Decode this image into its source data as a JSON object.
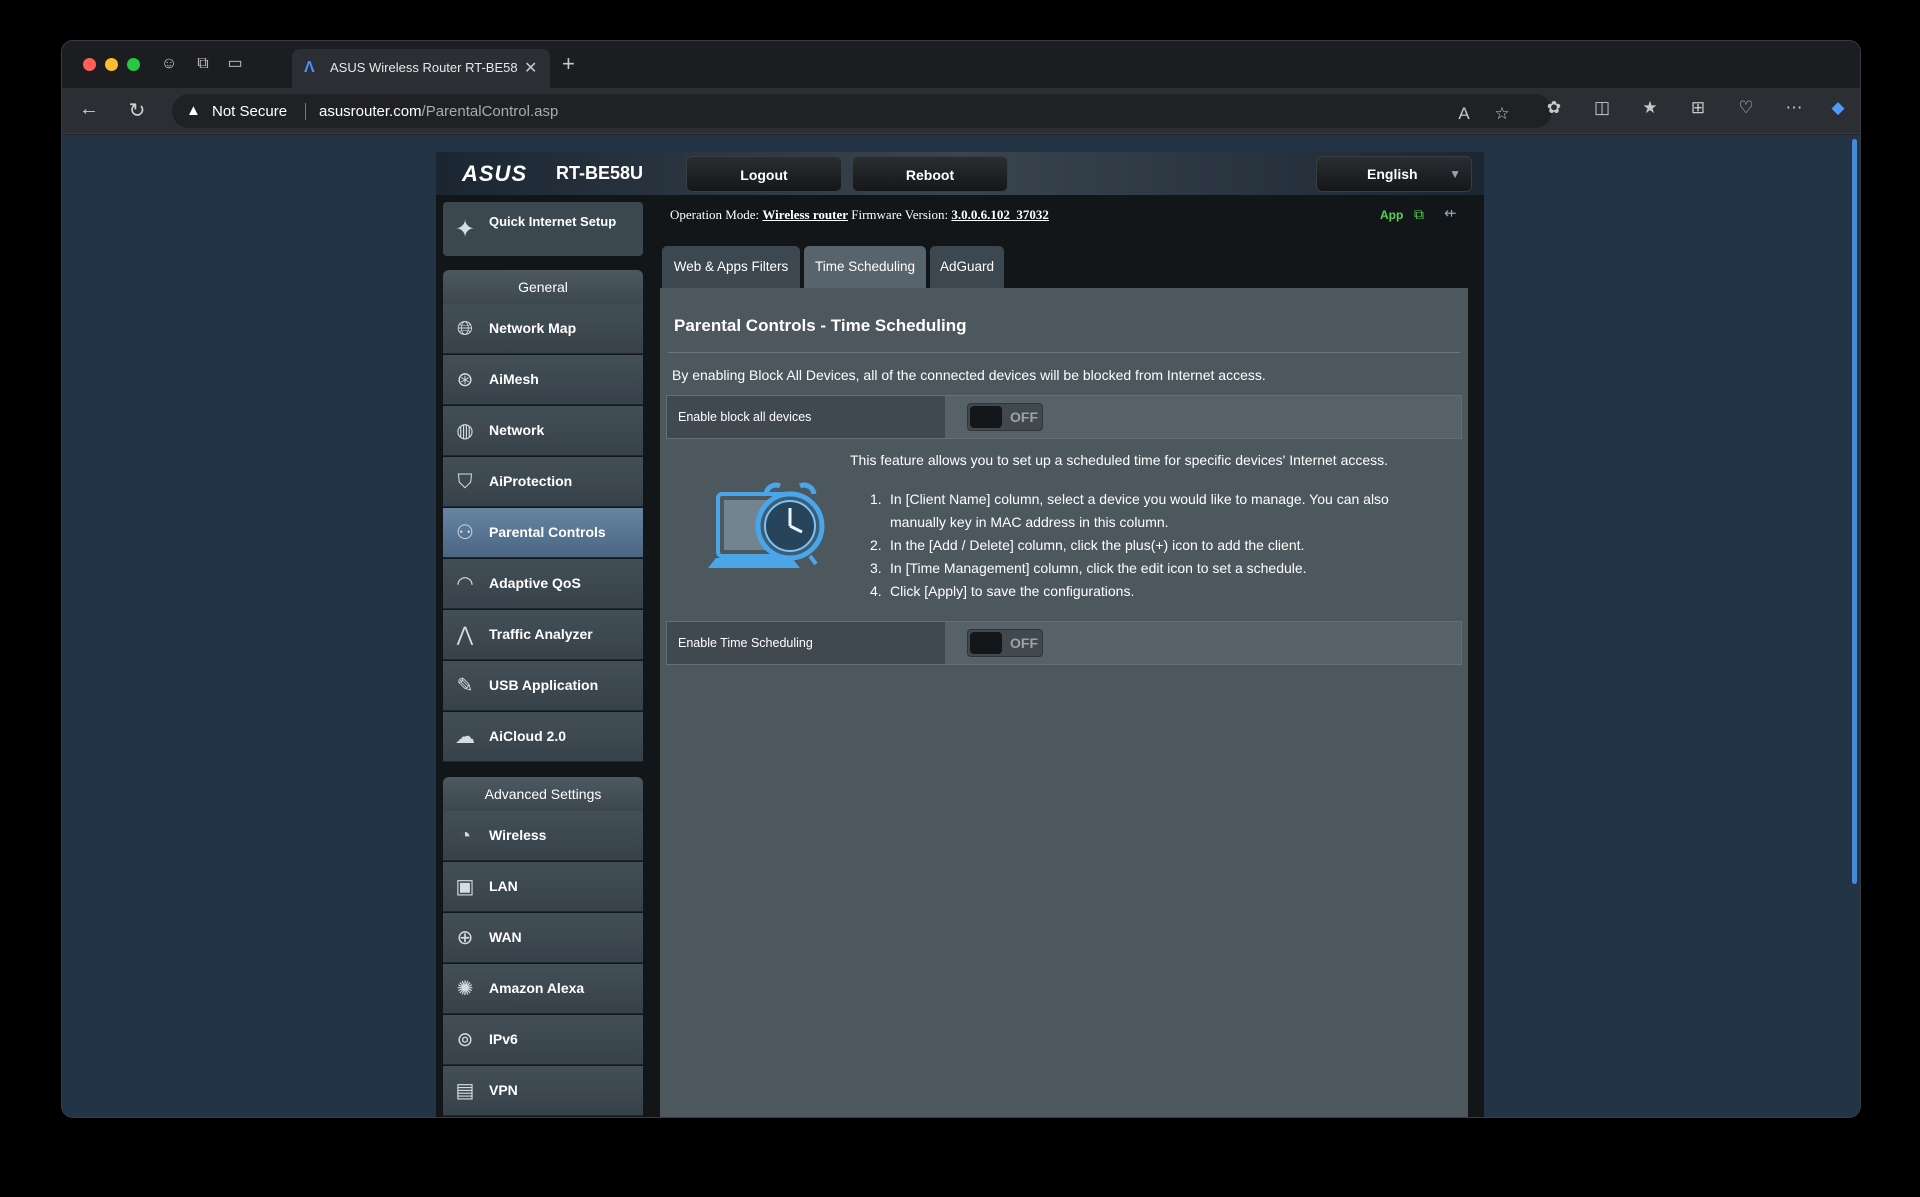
{
  "browser": {
    "tab_title": "ASUS Wireless Router RT-BE58U",
    "not_secure": "Not Secure",
    "url_host": "asusrouter.com",
    "url_path": "/ParentalControl.asp"
  },
  "router": {
    "brand": "ASUS",
    "model": "RT-BE58U",
    "logout": "Logout",
    "reboot": "Reboot",
    "language": "English",
    "opmode_label": "Operation Mode:",
    "opmode_value": "Wireless router",
    "firmware_label": "Firmware Version:",
    "firmware_value": "3.0.0.6.102_37032",
    "app_label": "App"
  },
  "sidebar": {
    "quick_setup": "Quick Internet Setup",
    "general_heading": "General",
    "general_items": [
      {
        "label": "Network Map",
        "icon": "globe-map-icon"
      },
      {
        "label": "AiMesh",
        "icon": "mesh-icon"
      },
      {
        "label": "Network",
        "icon": "network-icon"
      },
      {
        "label": "AiProtection",
        "icon": "shield-lock-icon"
      },
      {
        "label": "Parental Controls",
        "icon": "family-icon"
      },
      {
        "label": "Adaptive QoS",
        "icon": "speedometer-icon"
      },
      {
        "label": "Traffic Analyzer",
        "icon": "waveform-icon"
      },
      {
        "label": "USB Application",
        "icon": "usb-tools-icon"
      },
      {
        "label": "AiCloud 2.0",
        "icon": "cloud-icon"
      }
    ],
    "advanced_heading": "Advanced Settings",
    "advanced_items": [
      {
        "label": "Wireless",
        "icon": "wifi-icon"
      },
      {
        "label": "LAN",
        "icon": "monitor-icon"
      },
      {
        "label": "WAN",
        "icon": "globe-icon"
      },
      {
        "label": "Amazon Alexa",
        "icon": "alexa-icon"
      },
      {
        "label": "IPv6",
        "icon": "ipv6-icon"
      },
      {
        "label": "VPN",
        "icon": "vpn-icon"
      }
    ]
  },
  "tabs": [
    "Web & Apps Filters",
    "Time Scheduling",
    "AdGuard"
  ],
  "content": {
    "title": "Parental Controls - Time Scheduling",
    "block_desc": "By enabling Block All Devices, all of the connected devices will be blocked from Internet access.",
    "block_label": "Enable block all devices",
    "block_state": "OFF",
    "feature_intro": "This feature allows you to set up a scheduled time for specific devices' Internet access.",
    "steps": [
      "In [Client Name] column, select a device you would like to manage. You can also manually key in MAC address in this column.",
      "In the [Add / Delete] column, click the plus(+) icon to add the client.",
      "In [Time Management] column, click the edit icon to set a schedule.",
      "Click [Apply] to save the configurations."
    ],
    "schedule_label": "Enable Time Scheduling",
    "schedule_state": "OFF"
  }
}
